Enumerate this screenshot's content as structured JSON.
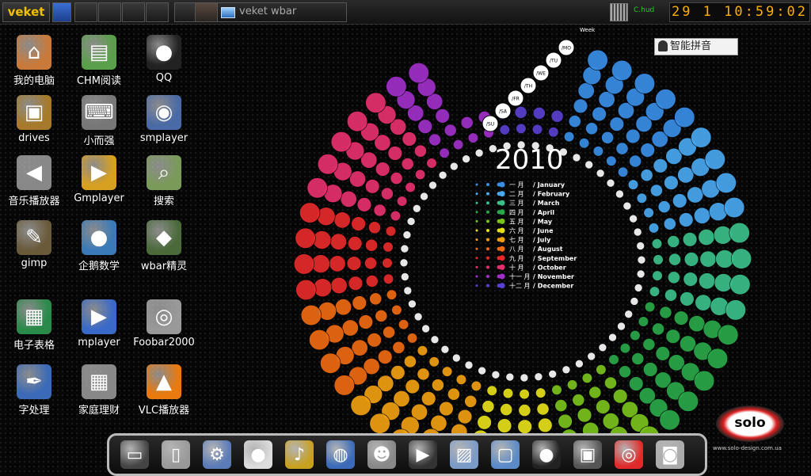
{
  "topbar": {
    "menu_label": "veket",
    "task_title": "veket wbar",
    "network_label": "C.hud",
    "clock": "29 1 10:59:02"
  },
  "desktop_icons": [
    {
      "label": "我的电脑",
      "icon": "home-icon"
    },
    {
      "label": "CHM阅读",
      "icon": "book-icon"
    },
    {
      "label": "QQ",
      "icon": "penguin-icon"
    },
    {
      "label": "drives",
      "icon": "box-icon"
    },
    {
      "label": "小而强",
      "icon": "keyboard-icon"
    },
    {
      "label": "smplayer",
      "icon": "film-icon"
    },
    {
      "label": "音乐播放器",
      "icon": "speaker-icon"
    },
    {
      "label": "Gmplayer",
      "icon": "player-icon"
    },
    {
      "label": "搜索",
      "icon": "search-icon"
    },
    {
      "label": "gimp",
      "icon": "gimp-icon"
    },
    {
      "label": "企鹅数学",
      "icon": "penguin-math-icon"
    },
    {
      "label": "wbar精灵",
      "icon": "wbar-icon"
    },
    {
      "label": "电子表格",
      "icon": "spreadsheet-icon"
    },
    {
      "label": "mplayer",
      "icon": "clapper-icon"
    },
    {
      "label": "Foobar2000",
      "icon": "speakers-icon"
    },
    {
      "label": "字处理",
      "icon": "pen-icon"
    },
    {
      "label": "家庭理财",
      "icon": "calculator-icon"
    },
    {
      "label": "VLC播放器",
      "icon": "vlc-cone-icon"
    }
  ],
  "wallpaper": {
    "year": "2010",
    "week_label": "Week",
    "months": [
      {
        "cn": "一 月",
        "en": "/ January",
        "color": "#3a8ee6"
      },
      {
        "cn": "二 月",
        "en": "/ February",
        "color": "#49a8f0"
      },
      {
        "cn": "三 月",
        "en": "/ March",
        "color": "#3cbf8a"
      },
      {
        "cn": "四 月",
        "en": "/ April",
        "color": "#2aa74a"
      },
      {
        "cn": "五 月",
        "en": "/ May",
        "color": "#7ac21c"
      },
      {
        "cn": "六 月",
        "en": "/ June",
        "color": "#e6e01a"
      },
      {
        "cn": "七 月",
        "en": "/ July",
        "color": "#f0a010"
      },
      {
        "cn": "八 月",
        "en": "/ August",
        "color": "#ec6a12"
      },
      {
        "cn": "九 月",
        "en": "/ September",
        "color": "#e62a2a"
      },
      {
        "cn": "十 月",
        "en": "/ October",
        "color": "#e6306e"
      },
      {
        "cn": "十一 月",
        "en": "/ November",
        "color": "#a030c8"
      },
      {
        "cn": "十二 月",
        "en": "/ December",
        "color": "#5a40d0"
      }
    ],
    "weekday_labels": [
      "/MO",
      "/TU",
      "/WE",
      "/TH",
      "/FR",
      "/SA",
      "/SU"
    ],
    "brand": "solo",
    "brand_url": "www.solo-design.com.ua"
  },
  "ime": {
    "label": "智能拼音"
  },
  "dock": {
    "items": [
      "folder-icon",
      "trash-icon",
      "settings-icon",
      "penguin-icon",
      "music-icon",
      "globe-icon",
      "robot-icon",
      "clapper-icon",
      "image-icon",
      "monitor-icon",
      "tux-icon",
      "screenshot-icon",
      "lifebuoy-icon",
      "camera-icon"
    ]
  }
}
